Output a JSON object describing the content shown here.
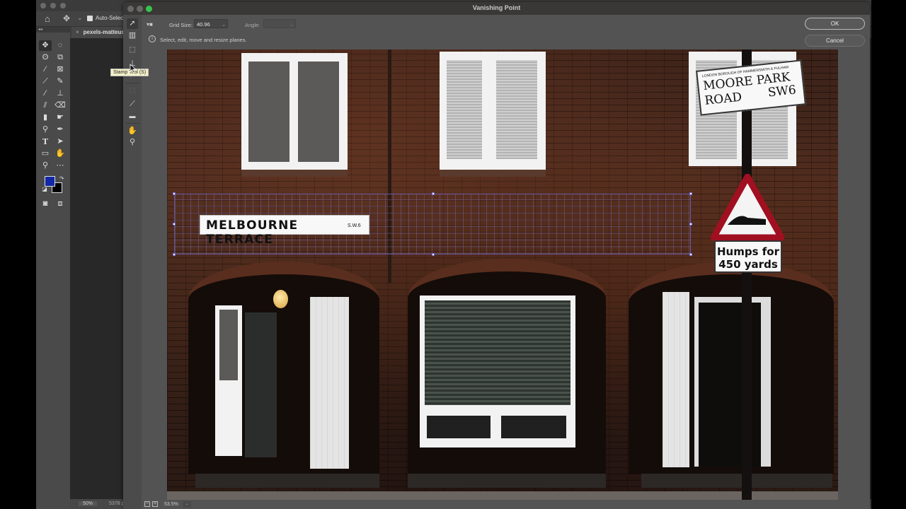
{
  "photoshop": {
    "options_bar": {
      "home_icon": "home-icon",
      "move_icon": "move-icon",
      "auto_select_label": "Auto-Select",
      "auto_select_checked": true
    },
    "document_tab": {
      "close_glyph": "×",
      "title": "pexels-matteus"
    },
    "tools": [
      "move-tool",
      "elliptical-marquee-tool",
      "lasso-tool",
      "object-selection-tool",
      "pen-tool",
      "frame-tool",
      "eyedropper-tool",
      "healing-brush-tool",
      "brush-tool",
      "clone-stamp-tool",
      "history-brush-tool",
      "eraser-tool",
      "gradient-tool",
      "smudge-tool",
      "dodge-tool",
      "pen-path-tool",
      "type-tool",
      "path-selection-tool",
      "rectangle-tool",
      "hand-tool",
      "zoom-tool",
      "more-tools",
      "quick-mask-mode",
      "screen-mode"
    ],
    "colors": {
      "foreground": "#1228a8",
      "background": "#000000"
    },
    "status": {
      "zoom": "50%",
      "dimensions": "5378 p"
    }
  },
  "vanishing_point": {
    "title": "Vanishing Point",
    "tools": [
      {
        "name": "edit-plane-tool",
        "label": "Edit Plane Tool (V)"
      },
      {
        "name": "create-plane-tool",
        "label": "Create Plane Tool (C)"
      },
      {
        "name": "marquee-tool",
        "label": "Marquee Tool (M)"
      },
      {
        "name": "stamp-tool",
        "label": "Stamp Tool (S)"
      },
      {
        "name": "brush-tool",
        "label": "Brush Tool (B)"
      },
      {
        "name": "transform-tool",
        "label": "Transform Tool (T)"
      },
      {
        "name": "eyedropper-tool",
        "label": "Eyedropper Tool (I)"
      },
      {
        "name": "measure-tool",
        "label": "Measure Tool (R)"
      },
      {
        "name": "hand-tool",
        "label": "Hand Tool (H)"
      },
      {
        "name": "zoom-tool",
        "label": "Zoom Tool (Z)"
      }
    ],
    "tooltip": "Stamp Tool (S)",
    "options": {
      "grid_size_label": "Grid Size:",
      "grid_size_value": "40.96",
      "angle_label": "Angle:",
      "angle_value": ""
    },
    "hint": "Select, edit, move and resize planes.",
    "buttons": {
      "ok": "OK",
      "cancel": "Cancel"
    },
    "status": {
      "zoom_out": "−",
      "zoom_in": "+",
      "zoom_value": "53.5%"
    },
    "photo_signs": {
      "melbourne_main": "MELBOURNE TERRACE",
      "melbourne_sub": "S.W.6",
      "moore_borough": "LONDON BOROUGH OF HAMMERSMITH & FULHAM",
      "moore_line1": "MOORE PARK",
      "moore_line2": "ROAD",
      "moore_line3": "SW6",
      "humps_line1": "Humps for",
      "humps_line2": "450 yards"
    }
  }
}
